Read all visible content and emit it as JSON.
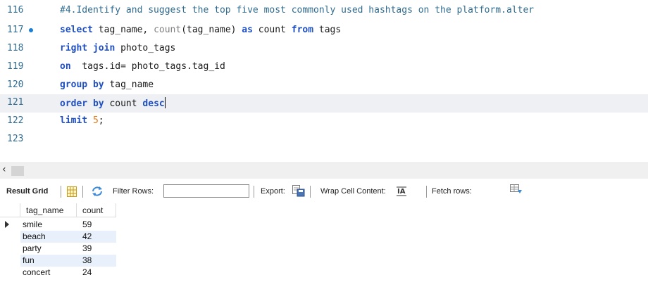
{
  "editor": {
    "lines": [
      {
        "num": "116",
        "comment": "#4.Identify and suggest the top five most commonly used hashtags on the platform.alter"
      },
      {
        "num": "117",
        "t": [
          "select",
          " tag_name, ",
          "count",
          "(tag_name) ",
          "as",
          " count ",
          "from",
          " tags"
        ]
      },
      {
        "num": "118",
        "t": [
          "right join",
          " photo_tags"
        ]
      },
      {
        "num": "119",
        "t": [
          "on",
          "  tags.id= photo_tags.tag_id"
        ]
      },
      {
        "num": "120",
        "t": [
          "group by",
          " tag_name"
        ]
      },
      {
        "num": "121",
        "t": [
          "order by",
          " count ",
          "desc"
        ]
      },
      {
        "num": "122",
        "t": [
          "limit",
          " ",
          "5",
          ";"
        ]
      },
      {
        "num": "123"
      }
    ]
  },
  "toolbar": {
    "result_grid": "Result Grid",
    "filter_rows": "Filter Rows:",
    "filter_value": "",
    "export": "Export:",
    "wrap": "Wrap Cell Content:",
    "fetch": "Fetch rows:"
  },
  "grid": {
    "columns": [
      "tag_name",
      "count"
    ],
    "rows": [
      [
        "smile",
        "59"
      ],
      [
        "beach",
        "42"
      ],
      [
        "party",
        "39"
      ],
      [
        "fun",
        "38"
      ],
      [
        "concert",
        "24"
      ]
    ]
  },
  "icons": {
    "breakpoint": "breakpoint-dot-icon",
    "scroll_left": "chevron-left-icon",
    "grid_icon": "grid-columns-icon",
    "refresh": "refresh-icon",
    "export_icon": "export-icon",
    "wrap_icon": "wrap-cell-icon",
    "fetch_icon": "fetch-rows-icon"
  },
  "colors": {
    "keyword": "#1f4fc1",
    "number": "#e07c1a",
    "comment": "#2f6b8f",
    "row_alt": "#e8f0fb"
  }
}
